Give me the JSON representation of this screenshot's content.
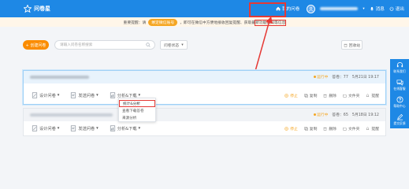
{
  "header": {
    "logo_text": "问卷星",
    "my_surveys": "我的问卷",
    "messages": "消息",
    "logout": "退出"
  },
  "notice": {
    "prefix": "重要提醒：请",
    "wechat_button": "绑定微信账号",
    "suffix": "，即可在微信中方便地接收回复提醒、获取最新功能通知等信息"
  },
  "toolbar": {
    "create_label": "+ 创建问卷",
    "search_placeholder": "请输入问卷名称搜索",
    "status_filter": "问卷状态",
    "recycle_label": "回收站"
  },
  "surveys": [
    {
      "status": "运行中",
      "answers": "答卷：77",
      "date": "5月21日 19:17",
      "actions": [
        "设计问卷",
        "发送问卷",
        "分析&下载"
      ],
      "right_actions": [
        "停止",
        "复制",
        "删除",
        "文件夹",
        "提醒"
      ]
    },
    {
      "status": "运行中",
      "answers": "答卷：65",
      "date": "5月18日 19:12",
      "actions": [
        "设计问卷",
        "发送问卷",
        "分析&下载"
      ],
      "right_actions": [
        "停止",
        "复制",
        "删除",
        "文件夹",
        "提醒"
      ]
    }
  ],
  "dropdown": {
    "items": [
      "统计&分析",
      "查看下载答卷",
      "来源分析"
    ]
  },
  "sidebar": {
    "items": [
      "联系我们",
      "在线客服",
      "帮助中心",
      "提交反馈"
    ]
  },
  "colors": {
    "brand": "#1e88e5",
    "accent": "#fb8c00",
    "highlight": "#e53935",
    "running": "#f5a623"
  }
}
